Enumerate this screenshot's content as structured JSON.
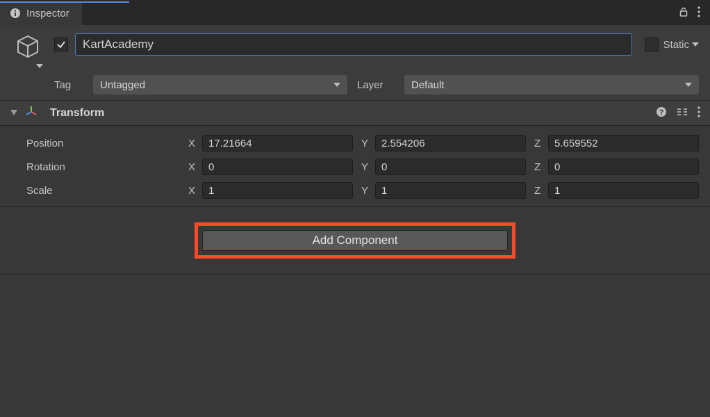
{
  "tab": {
    "title": "Inspector"
  },
  "header": {
    "name": "KartAcademy",
    "active": true,
    "static_label": "Static",
    "static_checked": false,
    "tag_label": "Tag",
    "tag_value": "Untagged",
    "layer_label": "Layer",
    "layer_value": "Default"
  },
  "transform": {
    "title": "Transform",
    "position": {
      "label": "Position",
      "x_label": "X",
      "y_label": "Y",
      "z_label": "Z",
      "x": "17.21664",
      "y": "2.554206",
      "z": "5.659552"
    },
    "rotation": {
      "label": "Rotation",
      "x_label": "X",
      "y_label": "Y",
      "z_label": "Z",
      "x": "0",
      "y": "0",
      "z": "0"
    },
    "scale": {
      "label": "Scale",
      "x_label": "X",
      "y_label": "Y",
      "z_label": "Z",
      "x": "1",
      "y": "1",
      "z": "1"
    }
  },
  "add_component_label": "Add Component"
}
